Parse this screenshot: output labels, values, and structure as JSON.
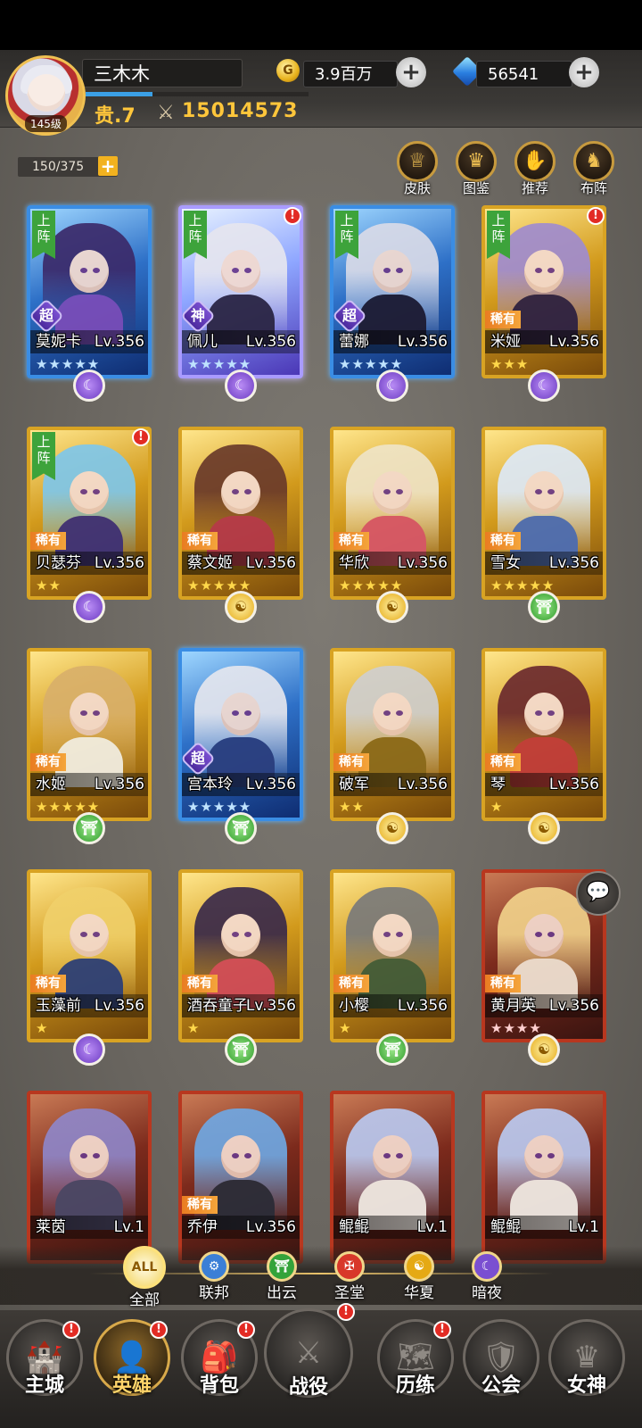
{
  "player": {
    "name": "三木木",
    "level": "145级",
    "vip": "贵.7",
    "power": "15014573",
    "gold": "3.9百万",
    "gems": "56541",
    "exp_fraction": 0.3
  },
  "hero_count": "150/375",
  "functions": [
    {
      "label": "皮肤",
      "icon": "skin-icon"
    },
    {
      "label": "图鉴",
      "icon": "crown-icon"
    },
    {
      "label": "推荐",
      "icon": "thumbs-up-icon"
    },
    {
      "label": "布阵",
      "icon": "chess-knight-icon"
    }
  ],
  "lineup_tag": "上阵",
  "rarity_tag": "稀有",
  "heroes": [
    {
      "name": "莫妮卡",
      "level": "Lv.356",
      "frame": "blue",
      "grade": "超",
      "lineup": true,
      "alert": false,
      "faction": "dark",
      "stars": "★★★★★"
    },
    {
      "name": "佩儿",
      "level": "Lv.356",
      "frame": "god",
      "grade": "神",
      "lineup": true,
      "alert": true,
      "faction": "dark",
      "stars": "★★★★★"
    },
    {
      "name": "蕾娜",
      "level": "Lv.356",
      "frame": "blue",
      "grade": "超",
      "lineup": true,
      "alert": false,
      "faction": "dark",
      "stars": "★★★★★"
    },
    {
      "name": "米娅",
      "level": "Lv.356",
      "frame": "gold",
      "grade": "稀有",
      "lineup": true,
      "alert": true,
      "faction": "dark",
      "stars": "★★★"
    },
    {
      "name": "贝瑟芬",
      "level": "Lv.356",
      "frame": "gold",
      "grade": "稀有",
      "lineup": true,
      "alert": true,
      "faction": "dark",
      "stars": "★★"
    },
    {
      "name": "蔡文姬",
      "level": "Lv.356",
      "frame": "gold",
      "grade": "稀有",
      "lineup": false,
      "alert": false,
      "faction": "huaxia",
      "stars": "★★★★★"
    },
    {
      "name": "华欣",
      "level": "Lv.356",
      "frame": "gold",
      "grade": "稀有",
      "lineup": false,
      "alert": false,
      "faction": "huaxia",
      "stars": "★★★★★"
    },
    {
      "name": "雪女",
      "level": "Lv.356",
      "frame": "gold",
      "grade": "稀有",
      "lineup": false,
      "alert": false,
      "faction": "chuyun",
      "stars": "★★★★★"
    },
    {
      "name": "水姬",
      "level": "Lv.356",
      "frame": "gold",
      "grade": "稀有",
      "lineup": false,
      "alert": false,
      "faction": "chuyun",
      "stars": "★★★★★"
    },
    {
      "name": "宫本玲",
      "level": "Lv.356",
      "frame": "blue",
      "grade": "超",
      "lineup": false,
      "alert": false,
      "faction": "chuyun",
      "stars": "★★★★★"
    },
    {
      "name": "破军",
      "level": "Lv.356",
      "frame": "gold",
      "grade": "稀有",
      "lineup": false,
      "alert": false,
      "faction": "huaxia",
      "stars": "★★"
    },
    {
      "name": "琴",
      "level": "Lv.356",
      "frame": "gold",
      "grade": "稀有",
      "lineup": false,
      "alert": false,
      "faction": "huaxia",
      "stars": "★"
    },
    {
      "name": "玉藻前",
      "level": "Lv.356",
      "frame": "gold",
      "grade": "稀有",
      "lineup": false,
      "alert": false,
      "faction": "dark",
      "stars": "★"
    },
    {
      "name": "酒吞童子",
      "level": "Lv.356",
      "frame": "gold",
      "grade": "稀有",
      "lineup": false,
      "alert": false,
      "faction": "chuyun",
      "stars": "★"
    },
    {
      "name": "小樱",
      "level": "Lv.356",
      "frame": "gold",
      "grade": "稀有",
      "lineup": false,
      "alert": false,
      "faction": "chuyun",
      "stars": "★"
    },
    {
      "name": "黄月英",
      "level": "Lv.356",
      "frame": "red",
      "grade": "稀有",
      "lineup": false,
      "alert": false,
      "faction": "huaxia",
      "stars": "★★★★"
    },
    {
      "name": "莱茵",
      "level": "Lv.1",
      "frame": "red",
      "grade": "",
      "lineup": false,
      "alert": false,
      "faction": "",
      "stars": ""
    },
    {
      "name": "乔伊",
      "level": "Lv.356",
      "frame": "red",
      "grade": "稀有",
      "lineup": false,
      "alert": false,
      "faction": "",
      "stars": ""
    },
    {
      "name": "鲲鲲",
      "level": "Lv.1",
      "frame": "red",
      "grade": "",
      "lineup": false,
      "alert": false,
      "faction": "",
      "stars": ""
    },
    {
      "name": "鲲鲲",
      "level": "Lv.1",
      "frame": "red",
      "grade": "",
      "lineup": false,
      "alert": false,
      "faction": "",
      "stars": ""
    }
  ],
  "filters": [
    {
      "label": "全部",
      "icon_text": "ALL",
      "active": true
    },
    {
      "label": "联邦",
      "icon_text": "⚙",
      "active": false
    },
    {
      "label": "出云",
      "icon_text": "⛩",
      "active": false
    },
    {
      "label": "圣堂",
      "icon_text": "✠",
      "active": false
    },
    {
      "label": "华夏",
      "icon_text": "☯",
      "active": false
    },
    {
      "label": "暗夜",
      "icon_text": "☾",
      "active": false
    }
  ],
  "nav": [
    {
      "label": "主城",
      "icon": "castle-icon",
      "alert": true,
      "active": false
    },
    {
      "label": "英雄",
      "icon": "hood-icon",
      "alert": true,
      "active": true
    },
    {
      "label": "背包",
      "icon": "backpack-icon",
      "alert": true,
      "active": false
    },
    {
      "label": "战役",
      "icon": "crossed-swords-icon",
      "alert": true,
      "active": false
    },
    {
      "label": "历练",
      "icon": "map-icon",
      "alert": true,
      "active": false
    },
    {
      "label": "公会",
      "icon": "shield-icon",
      "alert": false,
      "active": false
    },
    {
      "label": "女神",
      "icon": "goddess-icon",
      "alert": false,
      "active": false
    }
  ],
  "colors": {
    "gold_text": "#ffc63b",
    "lineup_green": "#3da33b",
    "alert_red": "#e22b24"
  }
}
